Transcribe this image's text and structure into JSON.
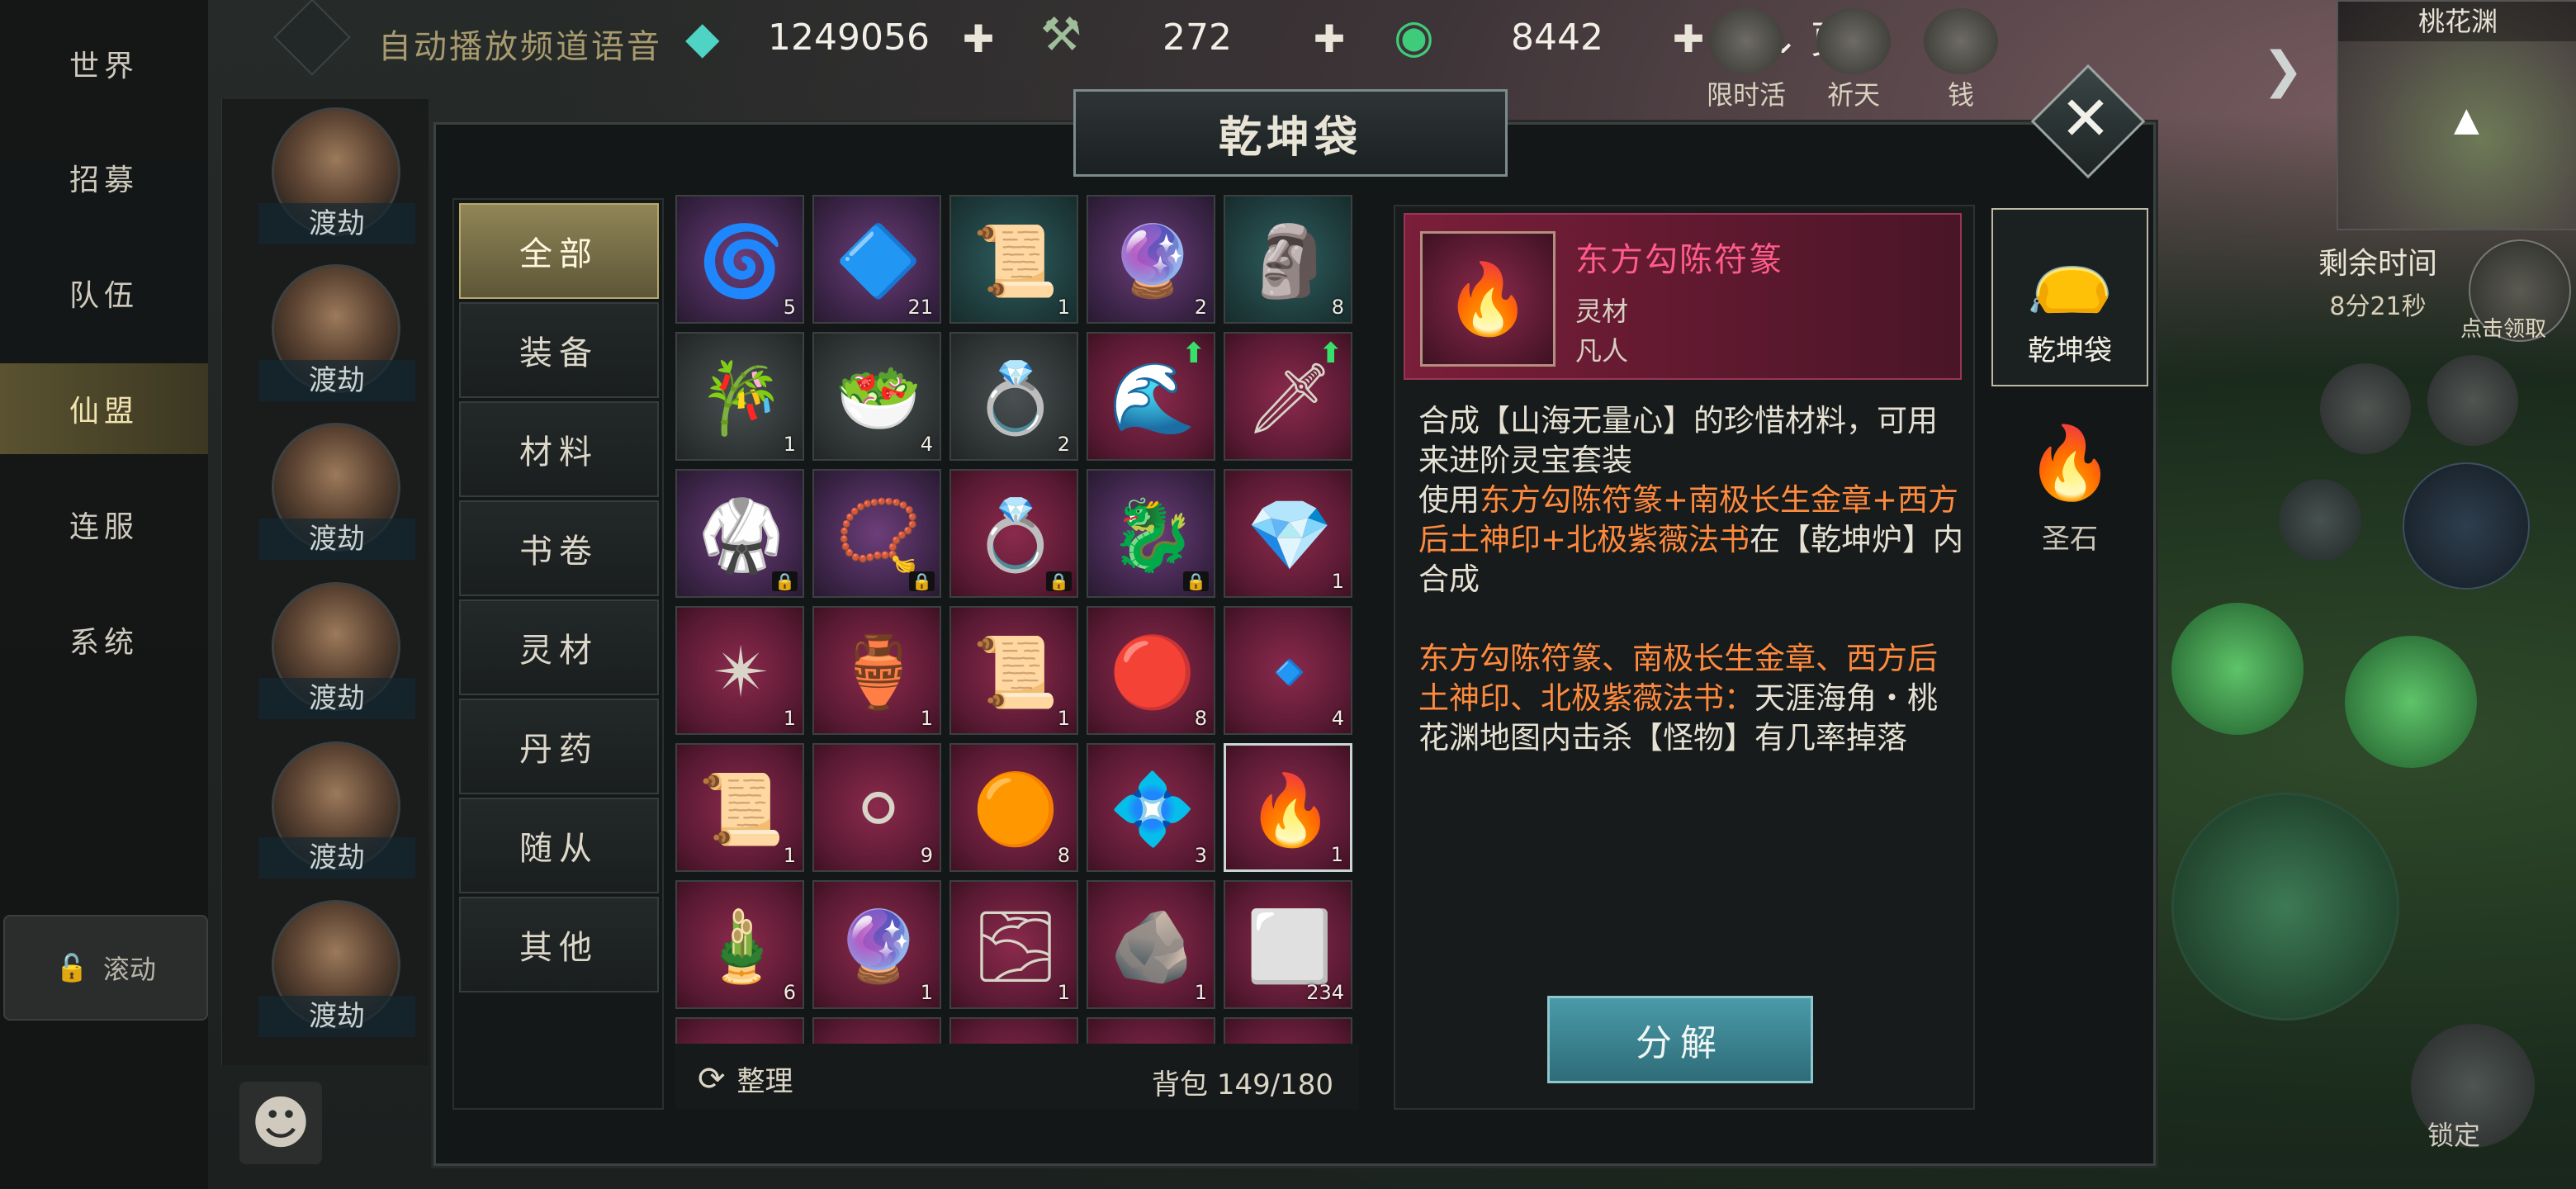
{
  "nav": {
    "items": [
      "世界",
      "招募",
      "队伍",
      "仙盟",
      "连服",
      "系统"
    ],
    "active_index": 3,
    "lock_label": "滚动"
  },
  "chat": {
    "channel_label": "自动播放频道语音",
    "avatars": [
      "渡劫",
      "渡劫",
      "渡劫",
      "渡劫",
      "渡劫",
      "渡劫"
    ]
  },
  "resources": {
    "spirit_stone": "1249056",
    "jade": "272",
    "coin": "8442",
    "more_label": "更多"
  },
  "top_icons": [
    "限时活动",
    "祈天",
    "钱"
  ],
  "minimap": {
    "title": "桃花渊"
  },
  "timer": {
    "label": "剩余时间",
    "value": "8分21秒"
  },
  "right_hud": {
    "lock_label": "锁定",
    "auto_label": "点击领取"
  },
  "panel": {
    "title": "乾坤袋",
    "categories": [
      "全部",
      "装备",
      "材料",
      "书卷",
      "灵材",
      "丹药",
      "随从",
      "其他"
    ],
    "active_category": 0,
    "sort_label": "整理",
    "bag_label": "背包",
    "bag_count": "149/180",
    "side_tabs": [
      {
        "label": "乾坤袋",
        "icon": "bag-icon",
        "active": true
      },
      {
        "label": "圣石",
        "icon": "brazier-icon",
        "active": false
      }
    ]
  },
  "items": [
    {
      "name": "swirl-essence",
      "bg": "purple",
      "glyph": "🌀",
      "count": "5"
    },
    {
      "name": "azure-dragon-orb",
      "bg": "purple",
      "glyph": "🔷",
      "count": "21"
    },
    {
      "name": "talisman-plaque",
      "bg": "teal",
      "glyph": "📜",
      "count": "1"
    },
    {
      "name": "pink-pearl",
      "bg": "purple",
      "glyph": "🔮",
      "count": "2"
    },
    {
      "name": "jade-buddha",
      "bg": "teal",
      "glyph": "🗿",
      "count": "8"
    },
    {
      "name": "fishing-rod",
      "bg": "gray",
      "glyph": "🎋",
      "count": "1"
    },
    {
      "name": "vegetable-dish",
      "bg": "gray",
      "glyph": "🥗",
      "count": "4"
    },
    {
      "name": "jade-rings",
      "bg": "gray",
      "glyph": "💍",
      "count": "2"
    },
    {
      "name": "cloud-armor",
      "bg": "red",
      "glyph": "🌊",
      "count": "",
      "upgrade": true
    },
    {
      "name": "azure-hairpin",
      "bg": "red",
      "glyph": "🗡",
      "count": "",
      "upgrade": true
    },
    {
      "name": "violet-robe",
      "bg": "purple",
      "glyph": "🥋",
      "count": "",
      "locked": true
    },
    {
      "name": "dragon-amulet",
      "bg": "purple",
      "glyph": "📿",
      "count": "",
      "locked": true
    },
    {
      "name": "golden-ring",
      "bg": "red",
      "glyph": "💍",
      "count": "",
      "locked": true
    },
    {
      "name": "dragon-orb",
      "bg": "purple",
      "glyph": "🐉",
      "count": "",
      "locked": true
    },
    {
      "name": "ice-crystal",
      "bg": "red",
      "glyph": "💎",
      "count": "1"
    },
    {
      "name": "rainbow-star",
      "bg": "red",
      "glyph": "✴",
      "count": "1"
    },
    {
      "name": "spirit-vase",
      "bg": "red",
      "glyph": "🏺",
      "count": "1"
    },
    {
      "name": "golden-scroll",
      "bg": "red",
      "glyph": "📜",
      "count": "1"
    },
    {
      "name": "fire-orb",
      "bg": "red",
      "glyph": "🔴",
      "count": "8"
    },
    {
      "name": "blue-crystal",
      "bg": "red",
      "glyph": "🔹",
      "count": "4"
    },
    {
      "name": "sun-scroll",
      "bg": "red",
      "glyph": "📜",
      "count": "1"
    },
    {
      "name": "lightning-orb",
      "bg": "red",
      "glyph": "⚪",
      "count": "9"
    },
    {
      "name": "flame-orb",
      "bg": "red",
      "glyph": "🟠",
      "count": "8"
    },
    {
      "name": "pink-gem",
      "bg": "red",
      "glyph": "💠",
      "count": "3"
    },
    {
      "name": "phoenix-talisman",
      "bg": "red",
      "glyph": "🔥",
      "count": "1",
      "selected": true
    },
    {
      "name": "bamboo-tube",
      "bg": "red",
      "glyph": "🎍",
      "count": "6"
    },
    {
      "name": "amethyst",
      "bg": "red",
      "glyph": "🔮",
      "count": "1"
    },
    {
      "name": "mist-pillar",
      "bg": "red",
      "glyph": "🌫",
      "count": "1"
    },
    {
      "name": "silver-ore",
      "bg": "red",
      "glyph": "🪨",
      "count": "1"
    },
    {
      "name": "silver-ingot",
      "bg": "red",
      "glyph": "⬜",
      "count": "234"
    }
  ],
  "selected_item": {
    "name": "东方勾陈符篆",
    "type": "灵材",
    "rank": "凡人",
    "desc1": "合成【山海无量心】的珍惜材料，可用来进阶灵宝套装",
    "desc2_prefix": "使用",
    "desc2_highlight": "东方勾陈符篆+南极长生金章+西方后土神印+北极紫薇法书",
    "desc2_suffix": "在【乾坤炉】内合成",
    "desc3_highlight": "东方勾陈符篆、南极长生金章、西方后土神印、北极紫薇法书：",
    "desc3_suffix": "天涯海角・桃花渊地图内击杀【怪物】有几率掉落",
    "dismantle_label": "分解"
  },
  "colors": {
    "accent_gold": "#8f8558",
    "name_pink": "#ff5c8a",
    "highlight_orange": "#ff8a3d",
    "button_teal": "#4a9aa9"
  }
}
